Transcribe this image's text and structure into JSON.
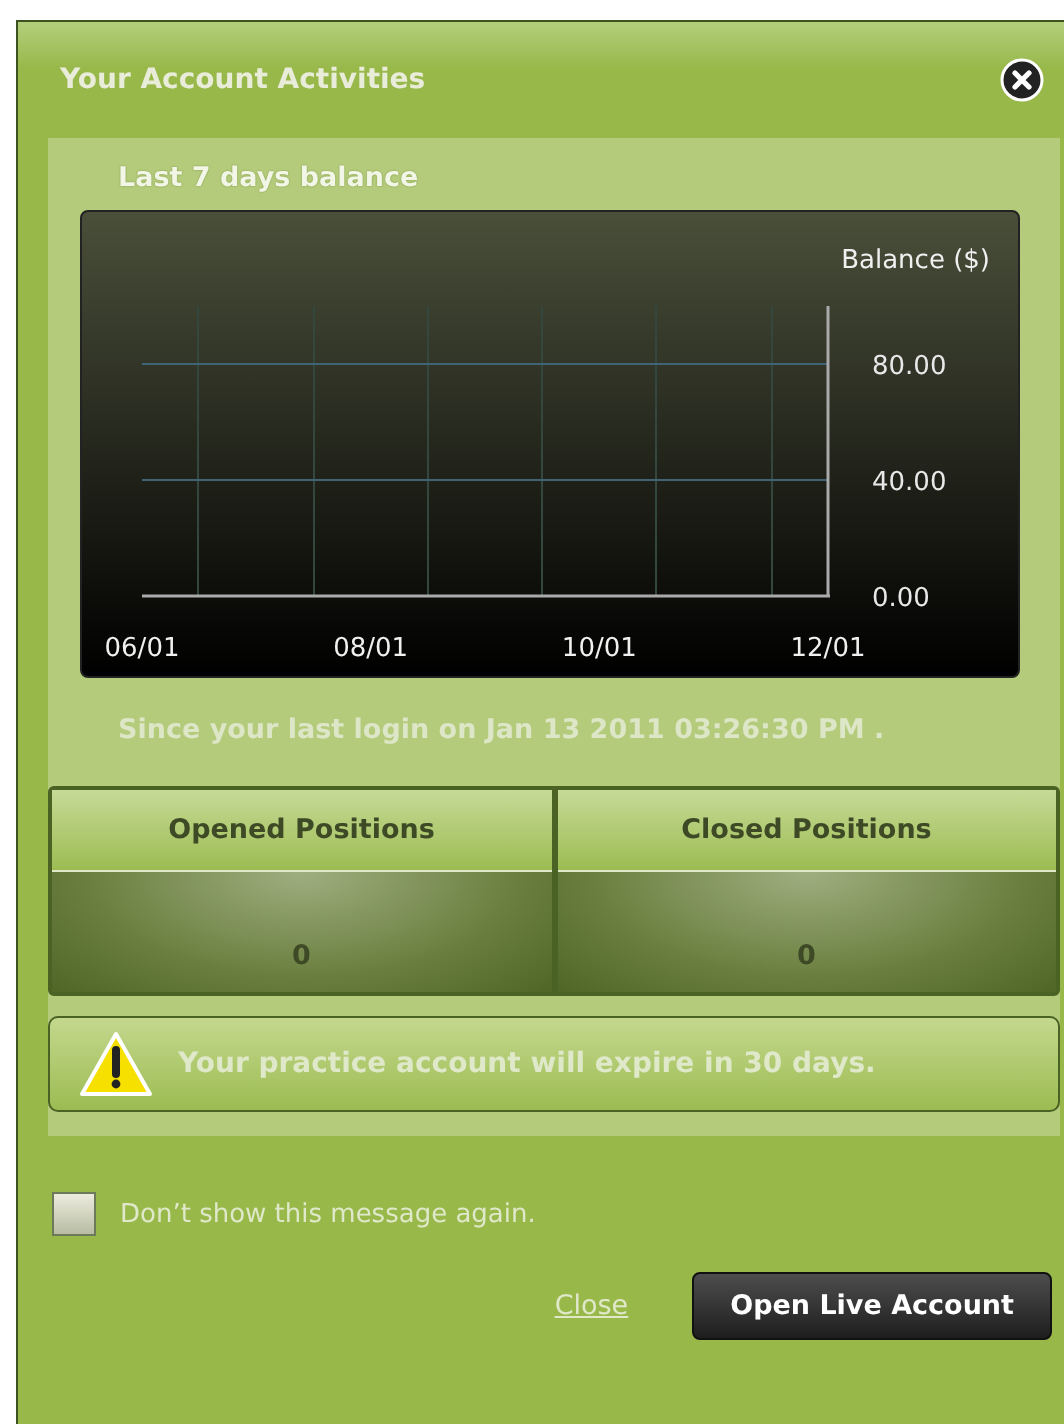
{
  "window": {
    "title": "Your Account Activities"
  },
  "chart_section": {
    "title": "Last 7 days balance",
    "chart_data": {
      "type": "line",
      "ylabel": "Balance ($)",
      "categories": [
        "06/01",
        "08/01",
        "10/01",
        "12/01"
      ],
      "ylim": [
        0,
        100
      ],
      "yticks": [
        {
          "value": 0,
          "label": "0.00"
        },
        {
          "value": 40,
          "label": "40.00"
        },
        {
          "value": 80,
          "label": "80.00"
        }
      ]
    }
  },
  "last_login": "Since your last login on Jan 13 2011 03:26:30 PM .",
  "positions": [
    {
      "label": "Opened Positions",
      "count": "0"
    },
    {
      "label": "Closed Positions",
      "count": "0"
    }
  ],
  "warning": "Your practice account will expire in 30 days.",
  "dont_show": {
    "label": "Don’t show this message again.",
    "checked": false
  },
  "close_link": "Close",
  "open_button": "Open Live Account"
}
